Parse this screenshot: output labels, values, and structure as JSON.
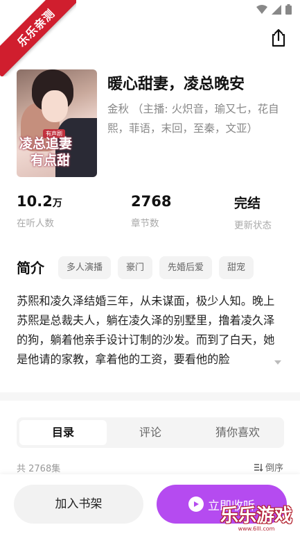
{
  "ribbon": {
    "text": "乐乐亲测"
  },
  "book": {
    "title": "暖心甜妻，凌总晚安",
    "author_line": "金秋 （主播: 火炽音，瑜又七，花自熙，菲语，末回，至秦，文亚）",
    "cover": {
      "badge": "有声剧",
      "title_line1": "凌总追妻",
      "title_line2": "有点甜"
    }
  },
  "stats": {
    "listeners": {
      "value": "10.2",
      "unit": "万",
      "label": "在听人数"
    },
    "chapters": {
      "value": "2768",
      "label": "章节数"
    },
    "status": {
      "value": "完结",
      "label": "更新状态"
    }
  },
  "intro": {
    "heading": "简介",
    "tags": [
      "多人演播",
      "豪门",
      "先婚后爱",
      "甜宠"
    ],
    "text": "苏熙和凌久泽结婚三年，从未谋面，极少人知。晚上苏熙是总裁夫人，躺在凌久泽的别墅里，撸着凌久泽的狗，躺着他亲手设计订制的沙发。而到了白天，她是他请的家教，拿着他的工资，要看他的脸"
  },
  "tabs": [
    {
      "label": "目录",
      "active": true
    },
    {
      "label": "评论",
      "active": false
    },
    {
      "label": "猜你喜欢",
      "active": false
    }
  ],
  "catalog": {
    "episode_count": "共 2768集",
    "sort_label": "倒序"
  },
  "actions": {
    "shelf": "加入书架",
    "listen": "立即收听"
  },
  "watermark": {
    "text": "乐乐游戏",
    "url": "www.6lll.com"
  },
  "colors": {
    "accent": "#b54bf0",
    "ribbon": "#d01e2e"
  }
}
